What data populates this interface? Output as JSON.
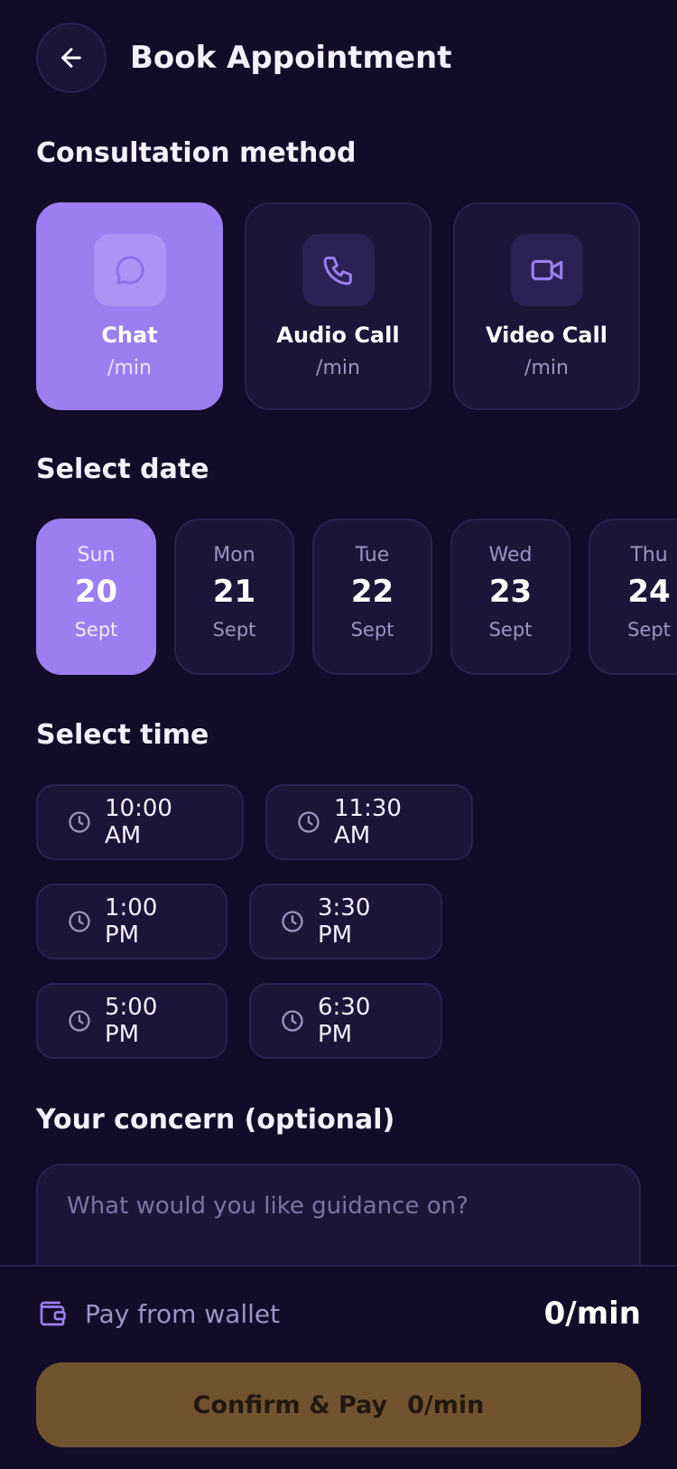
{
  "header": {
    "title": "Book Appointment",
    "back_icon": "arrow-left-icon"
  },
  "consultation": {
    "title": "Consultation method",
    "methods": [
      {
        "name": "Chat",
        "price": "/min",
        "icon": "chat-bubble-icon",
        "selected": true
      },
      {
        "name": "Audio Call",
        "price": "/min",
        "icon": "phone-icon",
        "selected": false
      },
      {
        "name": "Video Call",
        "price": "/min",
        "icon": "video-camera-icon",
        "selected": false
      }
    ]
  },
  "date_section": {
    "title": "Select date",
    "dates": [
      {
        "day": "Sun",
        "num": "20",
        "month": "Sept",
        "selected": true
      },
      {
        "day": "Mon",
        "num": "21",
        "month": "Sept",
        "selected": false
      },
      {
        "day": "Tue",
        "num": "22",
        "month": "Sept",
        "selected": false
      },
      {
        "day": "Wed",
        "num": "23",
        "month": "Sept",
        "selected": false
      },
      {
        "day": "Thu",
        "num": "24",
        "month": "Sept",
        "selected": false
      }
    ]
  },
  "time_section": {
    "title": "Select time",
    "slots": [
      "10:00 AM",
      "11:30 AM",
      "1:00 PM",
      "3:30 PM",
      "5:00 PM",
      "6:30 PM"
    ]
  },
  "concern": {
    "title": "Your concern (optional)",
    "placeholder": "What would you like guidance on?"
  },
  "footer": {
    "wallet_label": "Pay from wallet",
    "wallet_amount": "0/min",
    "confirm_label": "Confirm & Pay",
    "confirm_amount": "0/min"
  },
  "colors": {
    "background": "#120c28",
    "card": "#1c1538",
    "accent": "#9b7ff0",
    "confirm_button": "#71542f"
  }
}
